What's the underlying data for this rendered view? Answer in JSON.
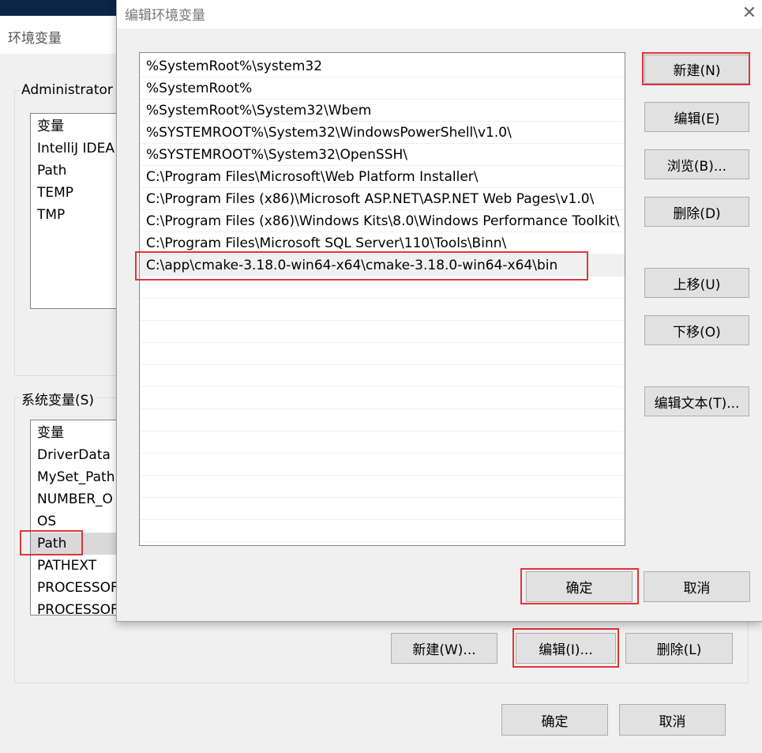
{
  "env_dialog": {
    "title": "环境变量",
    "user_group_label": "Administrator",
    "user_vars": {
      "header": "变量",
      "rows": [
        "IntelliJ IDEA",
        "Path",
        "TEMP",
        "TMP"
      ]
    },
    "system_group_label": "系统变量(S)",
    "system_vars": {
      "header": "变量",
      "rows": [
        "DriverData",
        "MySet_Path",
        "NUMBER_O",
        "OS",
        "Path",
        "PATHEXT",
        "PROCESSOF",
        "PROCESSOF"
      ]
    },
    "system_buttons": {
      "new": "新建(W)...",
      "edit": "编辑(I)...",
      "delete": "删除(L)"
    },
    "ok": "确定",
    "cancel": "取消"
  },
  "edit_dialog": {
    "title": "编辑环境变量",
    "close_glyph": "✕",
    "paths": [
      "%SystemRoot%\\system32",
      "%SystemRoot%",
      "%SystemRoot%\\System32\\Wbem",
      "%SYSTEMROOT%\\System32\\WindowsPowerShell\\v1.0\\",
      "%SYSTEMROOT%\\System32\\OpenSSH\\",
      "C:\\Program Files\\Microsoft\\Web Platform Installer\\",
      "C:\\Program Files (x86)\\Microsoft ASP.NET\\ASP.NET Web Pages\\v1.0\\",
      "C:\\Program Files (x86)\\Windows Kits\\8.0\\Windows Performance Toolkit\\",
      "C:\\Program Files\\Microsoft SQL Server\\110\\Tools\\Binn\\",
      "C:\\app\\cmake-3.18.0-win64-x64\\cmake-3.18.0-win64-x64\\bin"
    ],
    "buttons": {
      "new": "新建(N)",
      "edit": "编辑(E)",
      "browse": "浏览(B)...",
      "delete": "删除(D)",
      "move_up": "上移(U)",
      "move_down": "下移(O)",
      "edit_text": "编辑文本(T)..."
    },
    "ok": "确定",
    "cancel": "取消"
  },
  "highlight_color": "#e0353a"
}
